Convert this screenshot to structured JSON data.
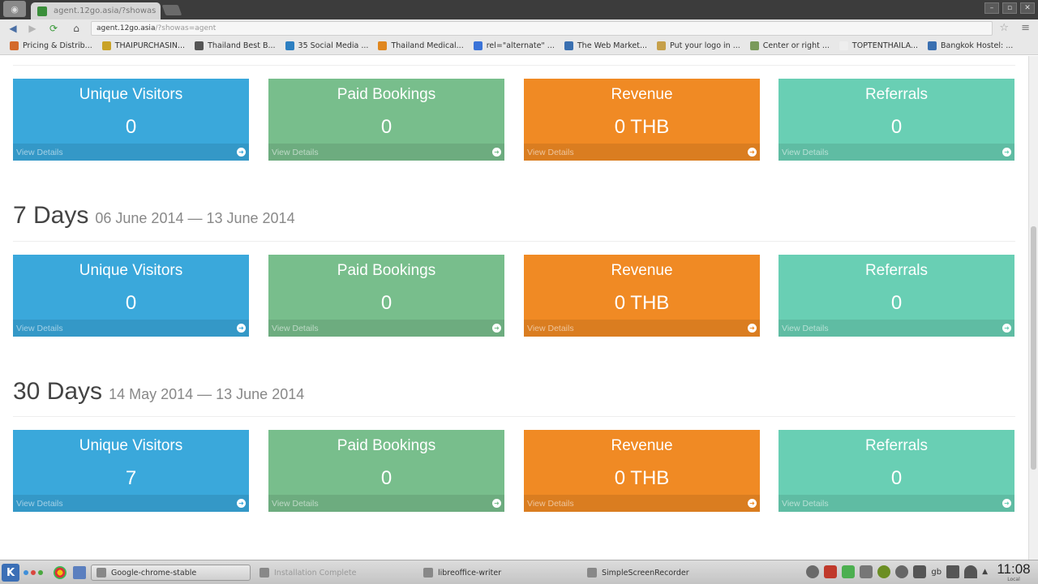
{
  "browser": {
    "tab_title": "agent.12go.asia/?showas",
    "url_host": "agent.12go.asia",
    "url_path": "/?showas=agent",
    "bookmarks": [
      {
        "label": "Pricing & Distrib...",
        "color": "#d46a2c"
      },
      {
        "label": "THAIPURCHASIN...",
        "color": "#c9a227"
      },
      {
        "label": "Thailand Best B...",
        "color": "#555555"
      },
      {
        "label": "35 Social Media ...",
        "color": "#2d7fc1"
      },
      {
        "label": "Thailand Medical...",
        "color": "#e0871f"
      },
      {
        "label": "rel=\"alternate\" ...",
        "color": "#3a73d8"
      },
      {
        "label": "The Web Market...",
        "color": "#3a6fb0"
      },
      {
        "label": "Put your logo in ...",
        "color": "#c6a04a"
      },
      {
        "label": "Center or right ...",
        "color": "#7a9a5a"
      },
      {
        "label": "TOPTENTHAILA...",
        "color": "#eeeeee"
      },
      {
        "label": "Bangkok Hostel: ...",
        "color": "#3a6fb0"
      }
    ]
  },
  "sections": [
    {
      "title": "",
      "range": "",
      "cards": [
        {
          "title": "Unique Visitors",
          "value": "0",
          "link": "View Details",
          "color": "#3aa8db"
        },
        {
          "title": "Paid Bookings",
          "value": "0",
          "link": "View Details",
          "color": "#78be8c"
        },
        {
          "title": "Revenue",
          "value": "0 THB",
          "link": "View Details",
          "color": "#f08a24"
        },
        {
          "title": "Referrals",
          "value": "0",
          "link": "View Details",
          "color": "#69cfb4"
        }
      ]
    },
    {
      "title": "7 Days",
      "range": "06 June 2014 — 13 June 2014",
      "cards": [
        {
          "title": "Unique Visitors",
          "value": "0",
          "link": "View Details",
          "color": "#3aa8db"
        },
        {
          "title": "Paid Bookings",
          "value": "0",
          "link": "View Details",
          "color": "#78be8c"
        },
        {
          "title": "Revenue",
          "value": "0 THB",
          "link": "View Details",
          "color": "#f08a24"
        },
        {
          "title": "Referrals",
          "value": "0",
          "link": "View Details",
          "color": "#69cfb4"
        }
      ]
    },
    {
      "title": "30 Days",
      "range": "14 May 2014 — 13 June 2014",
      "cards": [
        {
          "title": "Unique Visitors",
          "value": "7",
          "link": "View Details",
          "color": "#3aa8db"
        },
        {
          "title": "Paid Bookings",
          "value": "0",
          "link": "View Details",
          "color": "#78be8c"
        },
        {
          "title": "Revenue",
          "value": "0 THB",
          "link": "View Details",
          "color": "#f08a24"
        },
        {
          "title": "Referrals",
          "value": "0",
          "link": "View Details",
          "color": "#69cfb4"
        }
      ]
    }
  ],
  "taskbar": {
    "tasks": [
      {
        "label": "Google-chrome-stable",
        "active": true
      },
      {
        "label": "Installation Complete",
        "active": false
      },
      {
        "label": "libreoffice-writer",
        "active": false
      },
      {
        "label": "SimpleScreenRecorder",
        "active": false
      }
    ],
    "keyboard_layout": "gb",
    "clock_time": "11:08",
    "clock_sub": "Local"
  }
}
